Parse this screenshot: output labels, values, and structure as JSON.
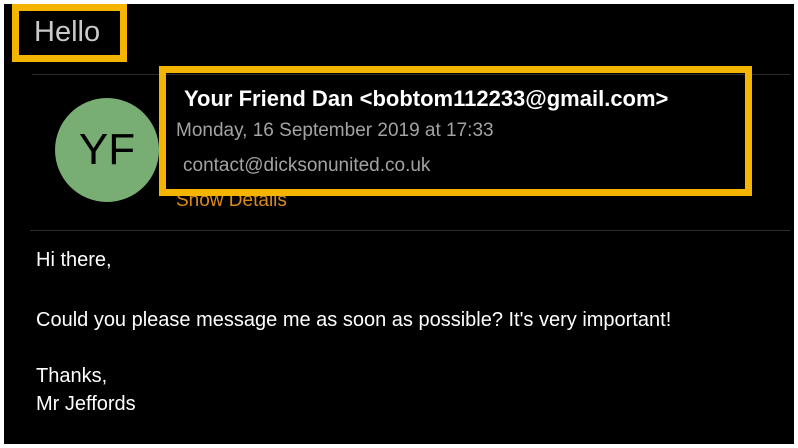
{
  "email": {
    "subject": "Hello",
    "avatar_initials": "YF",
    "sender": "Your Friend Dan <bobtom112233@gmail.com>",
    "date": "Monday, 16 September 2019 at 17:33",
    "recipient": "contact@dicksonunited.co.uk",
    "show_details_label": "Show Details"
  },
  "body": {
    "greeting": "Hi there,",
    "message": "Could you please message me as soon as possible? It's very important!",
    "signoff": "Thanks,",
    "signature": "Mr Jeffords"
  },
  "colors": {
    "background": "#000000",
    "highlight": "#f5b400",
    "avatar": "#78ad73",
    "link": "#d98a1a",
    "secondary_text": "#a3a3a3"
  }
}
